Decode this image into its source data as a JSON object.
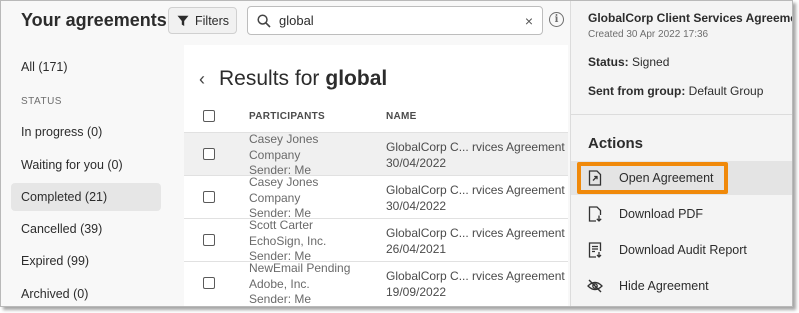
{
  "header": {
    "title": "Your agreements",
    "filters_label": "Filters",
    "search_value": "global",
    "clear_glyph": "×",
    "info_glyph": "i"
  },
  "sidebar": {
    "all": "All (171)",
    "status_heading": "STATUS",
    "items": [
      {
        "label": "In progress (0)"
      },
      {
        "label": "Waiting for you (0)"
      },
      {
        "label": "Completed (21)"
      },
      {
        "label": "Cancelled (39)"
      },
      {
        "label": "Expired (99)"
      },
      {
        "label": "Archived (0)"
      }
    ],
    "selected_index": 2
  },
  "results": {
    "prefix": "Results for",
    "query": "global",
    "back_glyph": "‹",
    "columns": [
      "PARTICIPANTS",
      "NAME"
    ],
    "rows": [
      {
        "p1": "Casey Jones",
        "p2": "Company",
        "p3": "Sender: Me",
        "name": "GlobalCorp C... rvices Agreement",
        "date": "30/04/2022"
      },
      {
        "p1": "Casey Jones",
        "p2": "Company",
        "p3": "Sender: Me",
        "name": "GlobalCorp C... rvices Agreement",
        "date": "30/04/2022"
      },
      {
        "p1": "Scott Carter",
        "p2": "EchoSign, Inc.",
        "p3": "Sender: Me",
        "name": "GlobalCorp C... rvices Agreement",
        "date": "26/04/2021"
      },
      {
        "p1": "NewEmail Pending",
        "p2": "Adobe, Inc.",
        "p3": "Sender: Me",
        "name": "GlobalCorp C... rvices Agreement",
        "date": "19/09/2022"
      }
    ]
  },
  "panel": {
    "title": "GlobalCorp Client Services Agreement",
    "created": "Created 30 Apr 2022 17:36",
    "status_label": "Status:",
    "status_value": "Signed",
    "group_label": "Sent from group:",
    "group_value": "Default Group",
    "actions_heading": "Actions",
    "actions": [
      {
        "label": "Open Agreement",
        "icon": "open-document-icon"
      },
      {
        "label": "Download PDF",
        "icon": "download-pdf-icon"
      },
      {
        "label": "Download Audit Report",
        "icon": "audit-report-icon"
      },
      {
        "label": "Hide Agreement",
        "icon": "hide-eye-icon"
      }
    ]
  },
  "colors": {
    "highlight_border": "#f0890a",
    "selected_bg": "#e6e6e6",
    "text": "#2c2c2c"
  }
}
